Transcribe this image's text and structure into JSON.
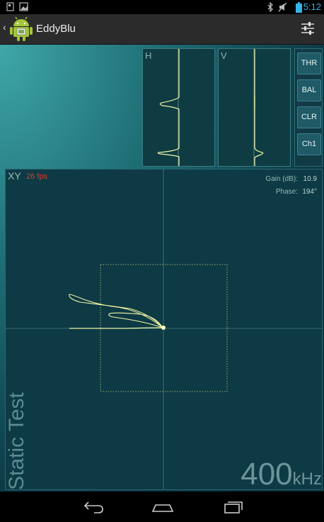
{
  "status_bar": {
    "time": "5:12",
    "left_icons": [
      "notification-icon",
      "image-icon"
    ],
    "right_icons": [
      "bluetooth-icon",
      "mute-icon",
      "battery-icon"
    ]
  },
  "action_bar": {
    "title": "EddyBlu",
    "settings_icon": "settings-sliders-icon",
    "accent": "#33b5e5"
  },
  "panels": {
    "h_label": "H",
    "v_label": "V"
  },
  "buttons": {
    "thr": "THR",
    "bal": "BAL",
    "clr": "CLR",
    "ch1": "Ch1"
  },
  "xy": {
    "label": "XY",
    "fps": "26 fps",
    "gain_label": "Gain (dB):",
    "gain_value": "10.9",
    "phase_label": "Phase:",
    "phase_value": "194°"
  },
  "mode_text": "Static Test",
  "frequency": {
    "value": "400",
    "unit": "kHz"
  },
  "nav_bar": {
    "buttons": [
      "back-icon",
      "home-icon",
      "recents-icon"
    ]
  },
  "colors": {
    "trace": "#f0f5a8",
    "fps": "#e03a2a",
    "status_time": "#33b5e5"
  }
}
